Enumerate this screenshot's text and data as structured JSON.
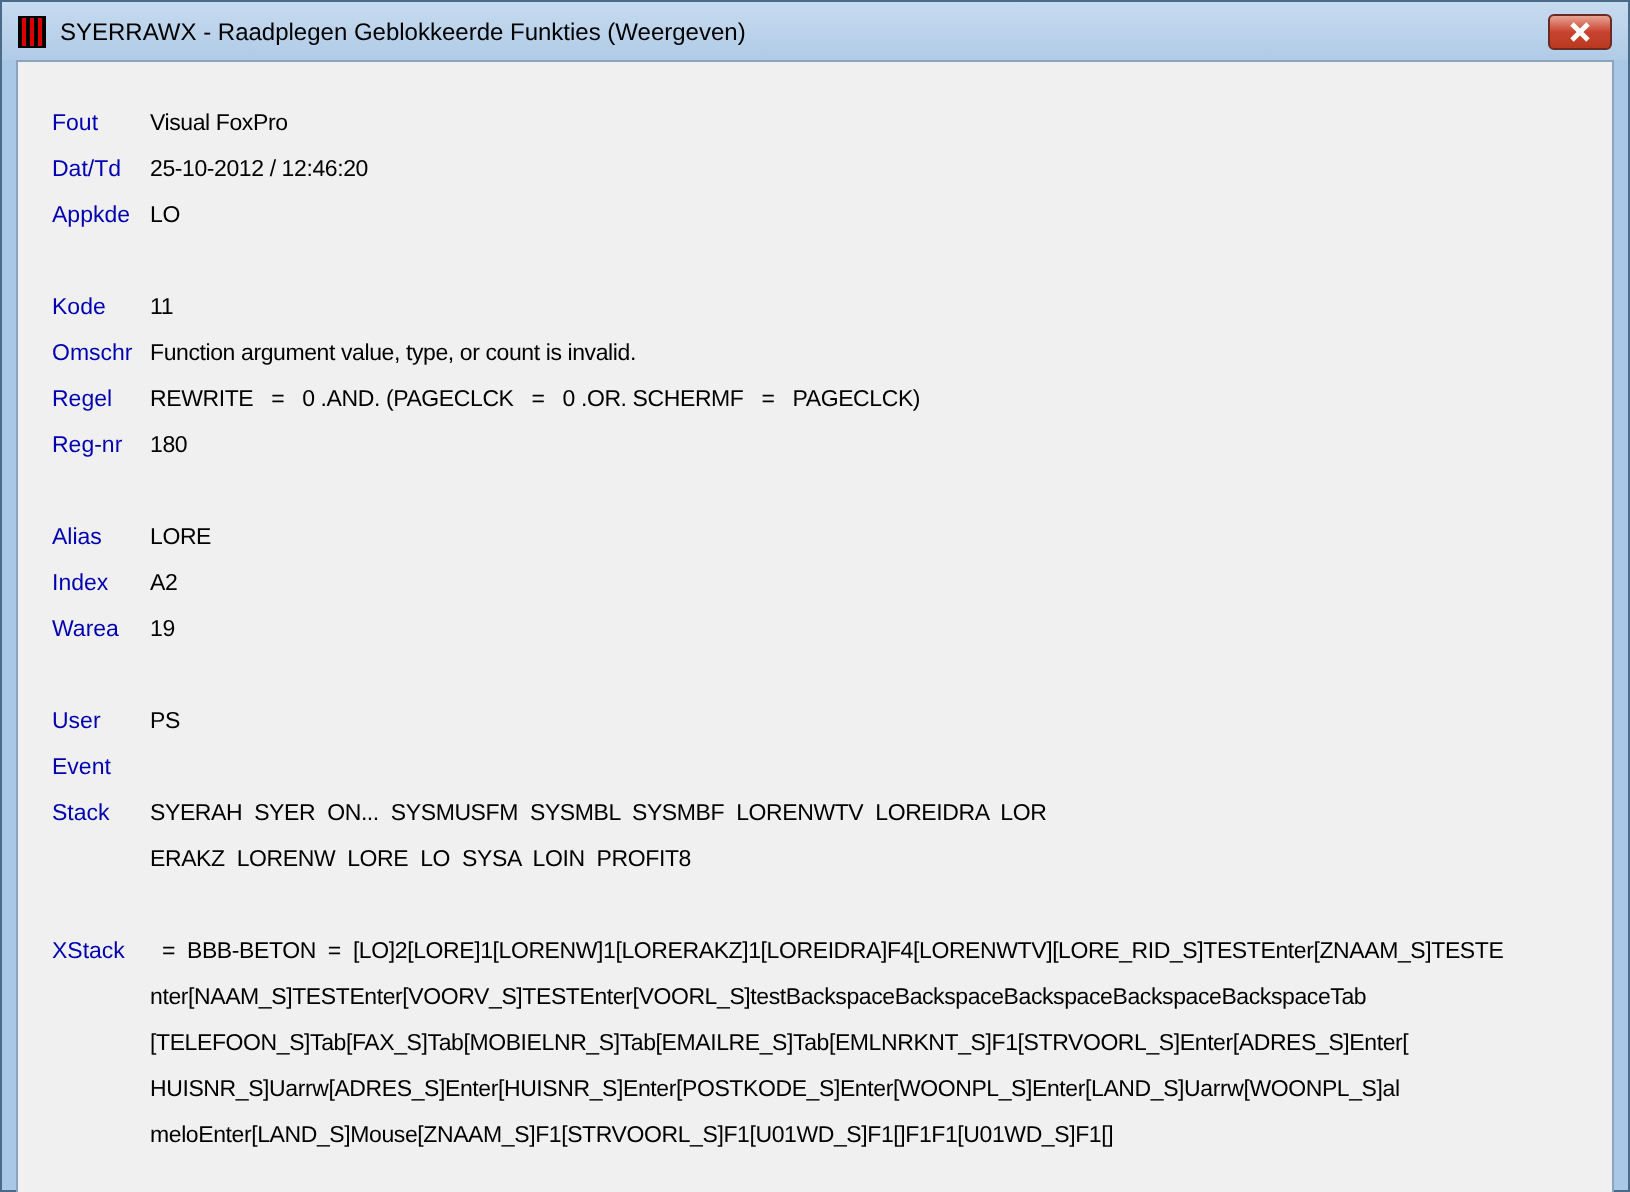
{
  "window": {
    "title": "SYERRAWX - Raadplegen Geblokkeerde Funkties (Weergeven)"
  },
  "groups": [
    {
      "fields": [
        {
          "label": "Fout",
          "lines": [
            "Visual FoxPro"
          ]
        },
        {
          "label": "Dat/Td",
          "lines": [
            "25-10-2012 / 12:46:20"
          ]
        },
        {
          "label": "Appkde",
          "lines": [
            "LO"
          ]
        }
      ]
    },
    {
      "fields": [
        {
          "label": "Kode",
          "lines": [
            "11"
          ]
        },
        {
          "label": "Omschr",
          "lines": [
            "Function argument value, type, or count is invalid."
          ]
        },
        {
          "label": "Regel",
          "lines": [
            "REWRITE   =   0 .AND. (PAGECLCK   =   0 .OR. SCHERMF   =   PAGECLCK)"
          ]
        },
        {
          "label": "Reg-nr",
          "lines": [
            "180"
          ]
        }
      ]
    },
    {
      "fields": [
        {
          "label": "Alias",
          "lines": [
            "LORE"
          ]
        },
        {
          "label": "Index",
          "lines": [
            "A2"
          ]
        },
        {
          "label": "Warea",
          "lines": [
            "19"
          ]
        }
      ]
    },
    {
      "fields": [
        {
          "label": "User",
          "lines": [
            "PS"
          ]
        },
        {
          "label": "Event"
        },
        {
          "label": "Stack",
          "lines": [
            "SYERAH  SYER  ON...  SYSMUSFM  SYSMBL  SYSMBF  LORENWTV  LOREIDRA  LOR",
            "ERAKZ  LORENW  LORE  LO  SYSA  LOIN  PROFIT8"
          ]
        }
      ]
    },
    {
      "fields": [
        {
          "label": "XStack",
          "lines": [
            "  =  BBB-BETON  =  [LO]2[LORE]1[LORENW]1[LORERAKZ]1[LOREIDRA]F4[LORENWTV][LORE_RID_S]TESTEnter[ZNAAM_S]TESTE",
            "nter[NAAM_S]TESTEnter[VOORV_S]TESTEnter[VOORL_S]testBackspaceBackspaceBackspaceBackspaceBackspaceTab",
            "[TELEFOON_S]Tab[FAX_S]Tab[MOBIELNR_S]Tab[EMAILRE_S]Tab[EMLNRKNT_S]F1[STRVOORL_S]Enter[ADRES_S]Enter[",
            "HUISNR_S]Uarrw[ADRES_S]Enter[HUISNR_S]Enter[POSTKODE_S]Enter[WOONPL_S]Enter[LAND_S]Uarrw[WOONPL_S]al",
            "meloEnter[LAND_S]Mouse[ZNAAM_S]F1[STRVOORL_S]F1[U01WD_S]F1[]F1F1[U01WD_S]F1[]"
          ]
        }
      ]
    }
  ]
}
